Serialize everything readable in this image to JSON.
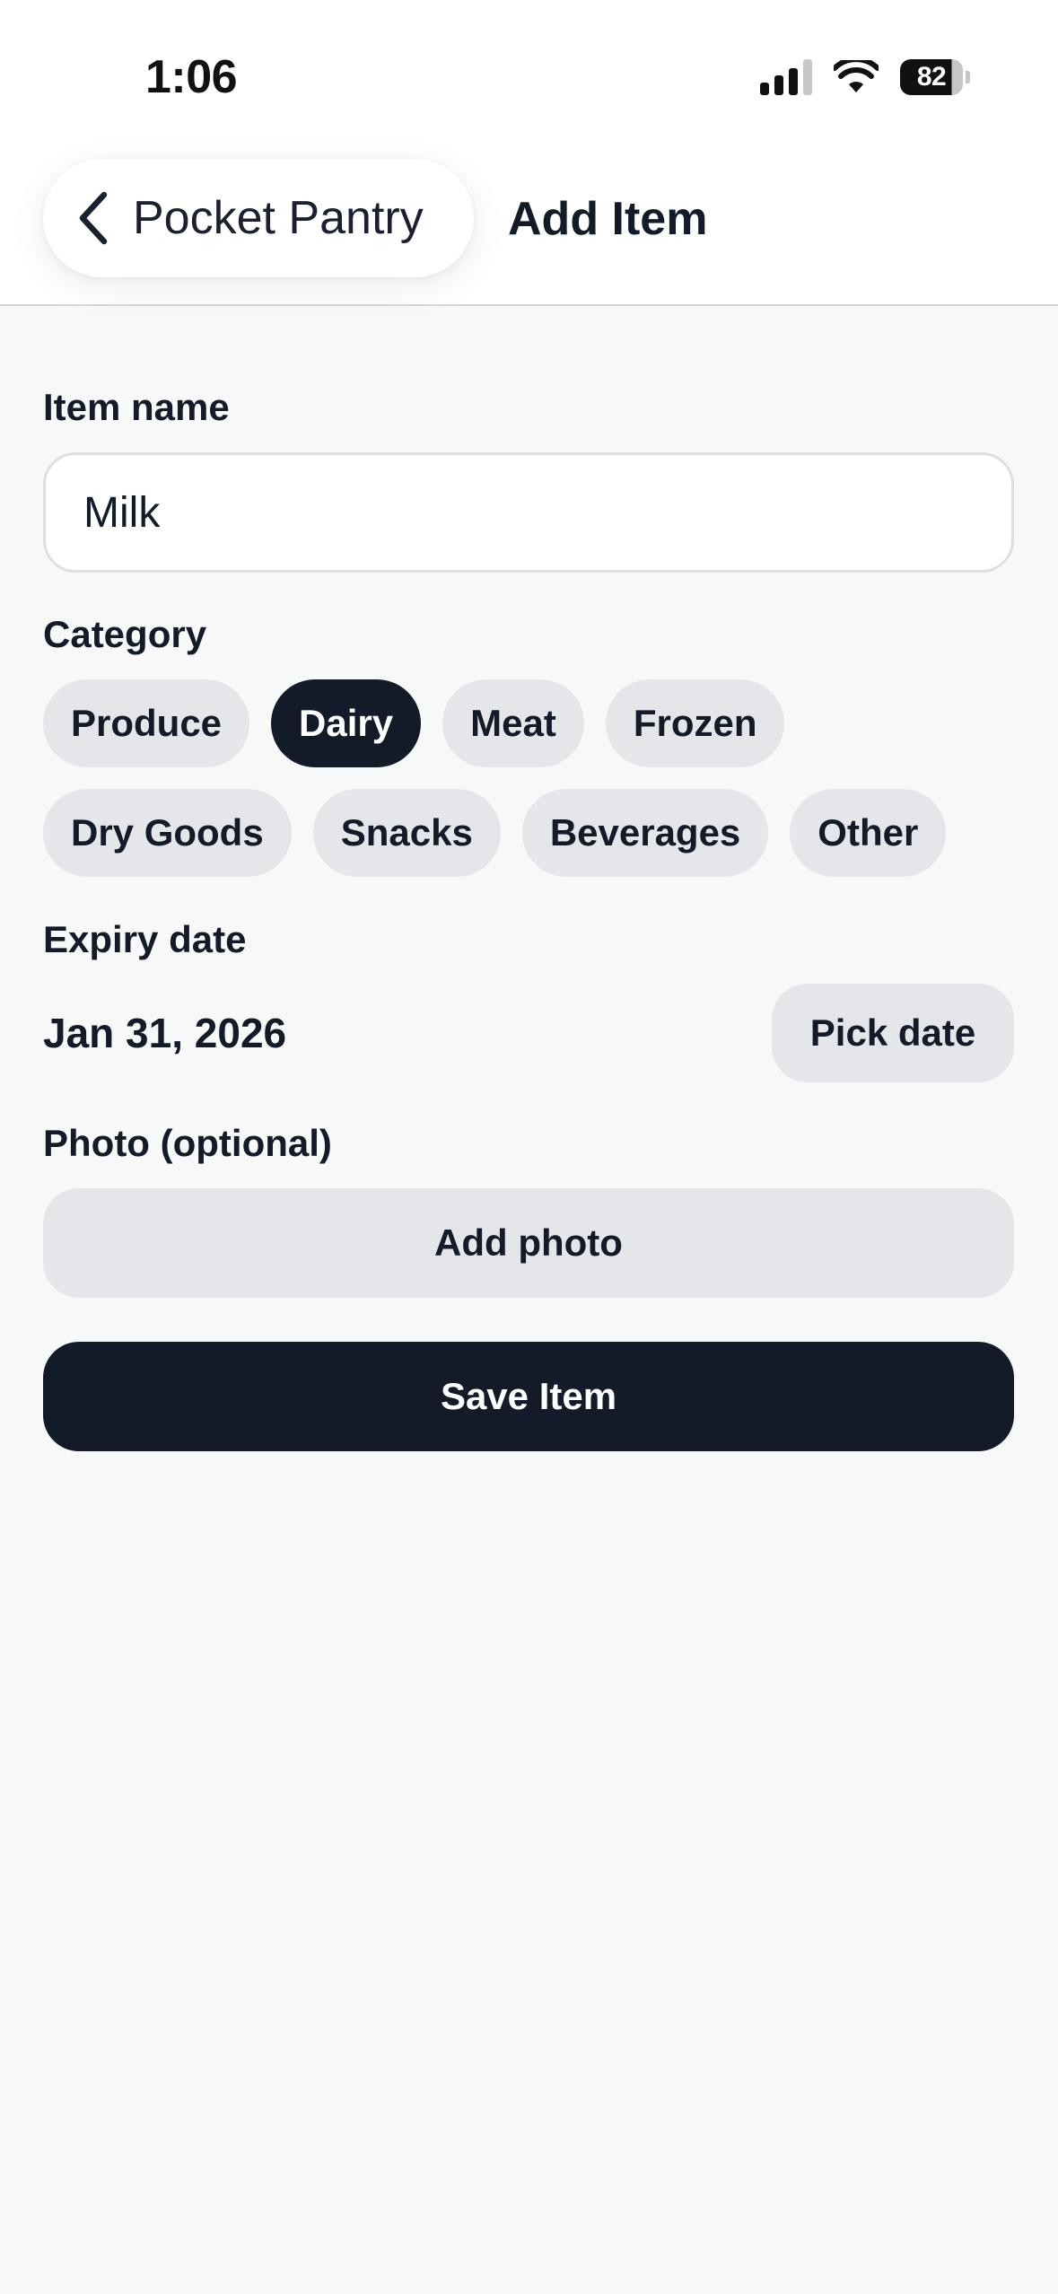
{
  "status_bar": {
    "time": "1:06",
    "battery_level": "82"
  },
  "nav": {
    "back_label": "Pocket Pantry",
    "title": "Add Item"
  },
  "form": {
    "item_name_label": "Item name",
    "item_name_value": "Milk",
    "category_label": "Category",
    "categories_row1": [
      "Produce",
      "Dairy",
      "Meat",
      "Frozen"
    ],
    "categories_row2": [
      "Dry Goods",
      "Snacks",
      "Beverages",
      "Other"
    ],
    "selected_category": "Dairy",
    "expiry_label": "Expiry date",
    "expiry_value": "Jan 31, 2026",
    "pick_date_label": "Pick date",
    "photo_label": "Photo (optional)",
    "add_photo_label": "Add photo",
    "save_label": "Save Item"
  },
  "colors": {
    "primary_dark": "#131a28",
    "chip_bg": "#e5e6ea",
    "page_bg": "#f7f8f8"
  }
}
